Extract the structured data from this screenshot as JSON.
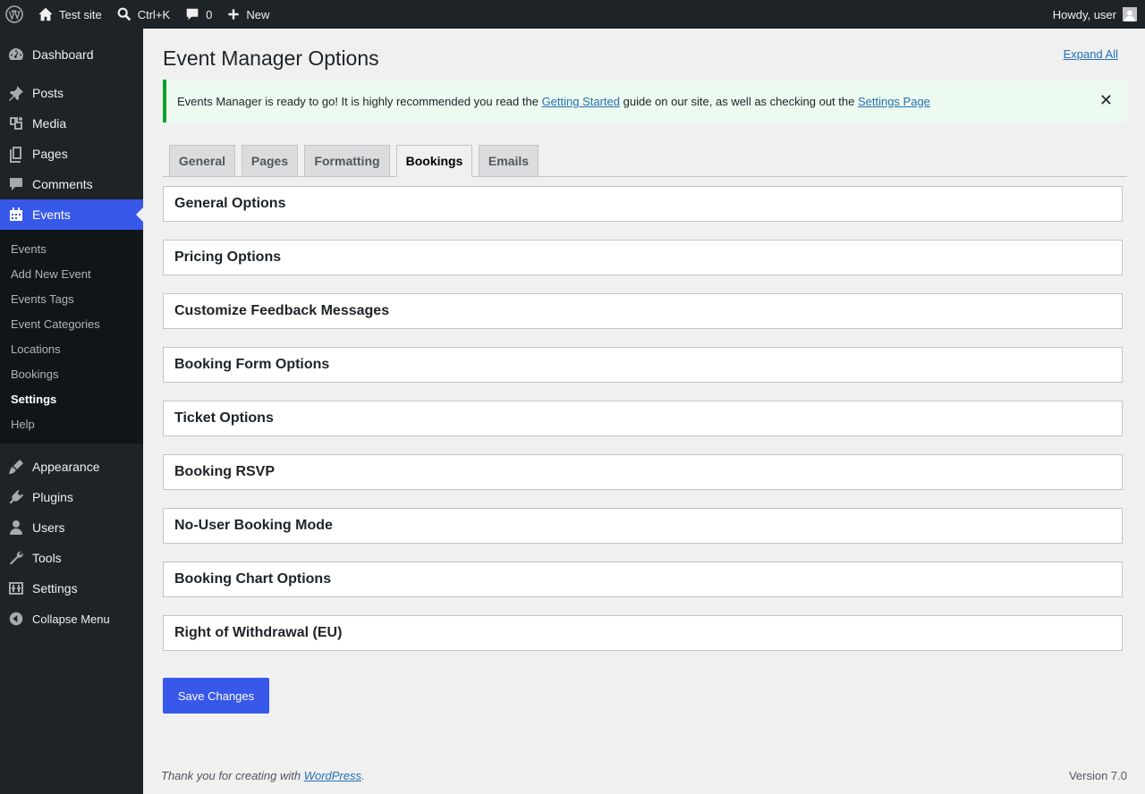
{
  "adminbar": {
    "site_name": "Test site",
    "search_shortcut": "Ctrl+K",
    "comments_count": "0",
    "new_label": "New",
    "greeting": "Howdy, user"
  },
  "sidebar": {
    "items": [
      {
        "label": "Dashboard",
        "icon": "dashboard-icon"
      },
      {
        "label": "Posts",
        "icon": "pin-icon"
      },
      {
        "label": "Media",
        "icon": "media-icon"
      },
      {
        "label": "Pages",
        "icon": "pages-icon"
      },
      {
        "label": "Comments",
        "icon": "comment-icon"
      },
      {
        "label": "Events",
        "icon": "calendar-icon"
      },
      {
        "label": "Appearance",
        "icon": "brush-icon"
      },
      {
        "label": "Plugins",
        "icon": "plug-icon"
      },
      {
        "label": "Users",
        "icon": "user-icon"
      },
      {
        "label": "Tools",
        "icon": "wrench-icon"
      },
      {
        "label": "Settings",
        "icon": "settings-icon"
      }
    ],
    "events_submenu": [
      "Events",
      "Add New Event",
      "Events Tags",
      "Event Categories",
      "Locations",
      "Bookings",
      "Settings",
      "Help"
    ],
    "collapse_label": "Collapse Menu",
    "accent_color": "#3858e9"
  },
  "main": {
    "title": "Event Manager Options",
    "expand_all": "Expand All",
    "notice": {
      "text_before": "Events Manager is ready to go! It is highly recommended you read the ",
      "link1": "Getting Started",
      "text_middle": " guide on our site, as well as checking out the ",
      "link2": "Settings Page",
      "dismiss": "✕"
    },
    "tabs": [
      {
        "label": "General"
      },
      {
        "label": "Pages"
      },
      {
        "label": "Formatting"
      },
      {
        "label": "Bookings"
      },
      {
        "label": "Emails"
      }
    ],
    "active_tab": "Bookings",
    "sections": [
      "General Options",
      "Pricing Options",
      "Customize Feedback Messages",
      "Booking Form Options",
      "Ticket Options",
      "Booking RSVP",
      "No-User Booking Mode",
      "Booking Chart Options",
      "Right of Withdrawal (EU)"
    ],
    "save_label": "Save Changes"
  },
  "footer": {
    "thanks_before": "Thank you for creating with ",
    "thanks_link": "WordPress",
    "thanks_after": ".",
    "version": "Version 7.0"
  }
}
